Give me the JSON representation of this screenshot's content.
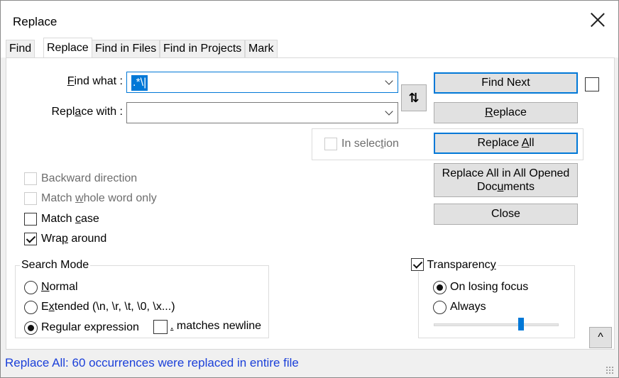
{
  "window": {
    "title": "Replace",
    "close_icon": "close-icon"
  },
  "tabs": [
    {
      "label": "Find",
      "active": false
    },
    {
      "label": "Replace",
      "active": true
    },
    {
      "label": "Find in Files",
      "active": false
    },
    {
      "label": "Find in Projects",
      "active": false
    },
    {
      "label": "Mark",
      "active": false
    }
  ],
  "find": {
    "label_pre": "",
    "label_acc": "F",
    "label_post": "ind what :",
    "value": ".*\\|",
    "placeholder": ""
  },
  "replace": {
    "label_pre": "Repl",
    "label_acc": "a",
    "label_post": "ce with :",
    "value": "",
    "placeholder": ""
  },
  "swap_button": {
    "icon": "swap-icon",
    "glyph": "⇅"
  },
  "buttons": {
    "find_next": "Find Next",
    "replace_pre": "",
    "replace_acc": "R",
    "replace_post": "eplace",
    "replace_all_pre": "Replace ",
    "replace_all_acc": "A",
    "replace_all_post": "ll",
    "replace_all_opened_line1": "Replace All in All Opened",
    "replace_all_opened_line2_pre": "Doc",
    "replace_all_opened_line2_acc": "u",
    "replace_all_opened_line2_post": "ments",
    "close": "Close"
  },
  "in_selection": {
    "label_pre": "In selec",
    "label_acc": "t",
    "label_post": "ion",
    "checked": false,
    "enabled": false
  },
  "options": {
    "backward_direction": {
      "label": "Backward direction",
      "checked": false,
      "enabled": false
    },
    "match_whole_word": {
      "label_pre": "Match ",
      "label_acc": "w",
      "label_post": "hole word only",
      "checked": false,
      "enabled": false
    },
    "match_case": {
      "label_pre": "Match ",
      "label_acc": "c",
      "label_post": "ase",
      "checked": false,
      "enabled": true
    },
    "wrap_around": {
      "label_pre": "Wra",
      "label_acc": "p",
      "label_post": " around",
      "checked": true,
      "enabled": true
    }
  },
  "search_mode": {
    "title": "Search Mode",
    "normal": {
      "acc": "N",
      "rest": "ormal",
      "selected": false
    },
    "extended": {
      "pre": "E",
      "acc": "x",
      "rest": "tended (\\n, \\r, \\t, \\0, \\x...)",
      "selected": false
    },
    "regex": {
      "pre": "Re",
      "acc": "g",
      "rest": "ular expression",
      "selected": true
    },
    "dot_newline": {
      "acc": ".",
      "rest": " matches newline",
      "checked": false
    }
  },
  "transparency": {
    "label_pre": "Transparenc",
    "label_acc": "y",
    "label_post": "",
    "checked": true,
    "on_losing_focus": {
      "label": "On losing focus",
      "selected": true
    },
    "always": {
      "label": "Always",
      "selected": false
    },
    "slider_level": 0.7
  },
  "collapse_button": {
    "glyph": "^",
    "icon": "chevron-up-icon"
  },
  "status": {
    "text": "Replace All: 60 occurrences were replaced in entire file",
    "color": "#1a3fd9"
  },
  "colors": {
    "accent": "#0078d7",
    "button_bg": "#e1e1e1"
  }
}
